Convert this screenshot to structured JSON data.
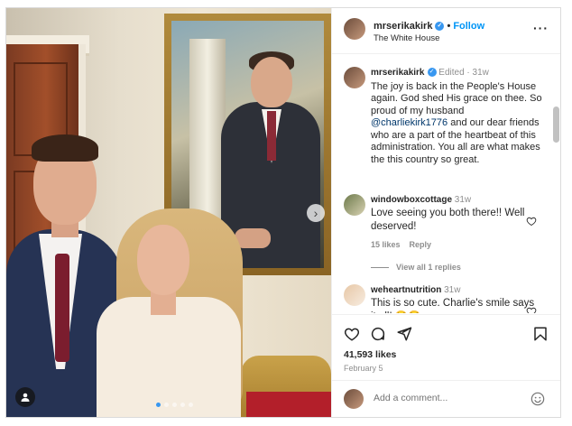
{
  "post": {
    "username": "mrserikakirk",
    "follow_label": "Follow",
    "location": "The White House",
    "likes": "41,593 likes",
    "date": "February 5"
  },
  "caption": {
    "username": "mrserikakirk",
    "edited": "Edited",
    "age": "31w",
    "text_before": "The joy is back in the People's House again. God shed His grace on thee. So proud of my husband ",
    "mention": "@charliekirk1776",
    "text_after": " and our dear friends who are a part of the heartbeat of this administration. You all are what makes the this country so great."
  },
  "comments": [
    {
      "username": "windowboxcottage",
      "age": "31w",
      "text": "Love seeing you both there!! Well deserved!",
      "likes": "15 likes",
      "reply": "Reply",
      "view_replies": "View all 1 replies"
    },
    {
      "username": "weheartnutrition",
      "age": "31w",
      "text": "This is so cute. Charlie's smile says it all! 😂😭"
    }
  ],
  "add_comment": {
    "placeholder": "Add a comment..."
  },
  "icons": [
    "verified-icon",
    "more-icon",
    "heart-icon",
    "comment-icon",
    "share-icon",
    "bookmark-icon",
    "emoji-icon",
    "tag-user-icon",
    "next-arrow-icon"
  ],
  "colors": {
    "accent": "#0095f6",
    "verified": "#3897f0",
    "muted": "#8e8e8e"
  }
}
